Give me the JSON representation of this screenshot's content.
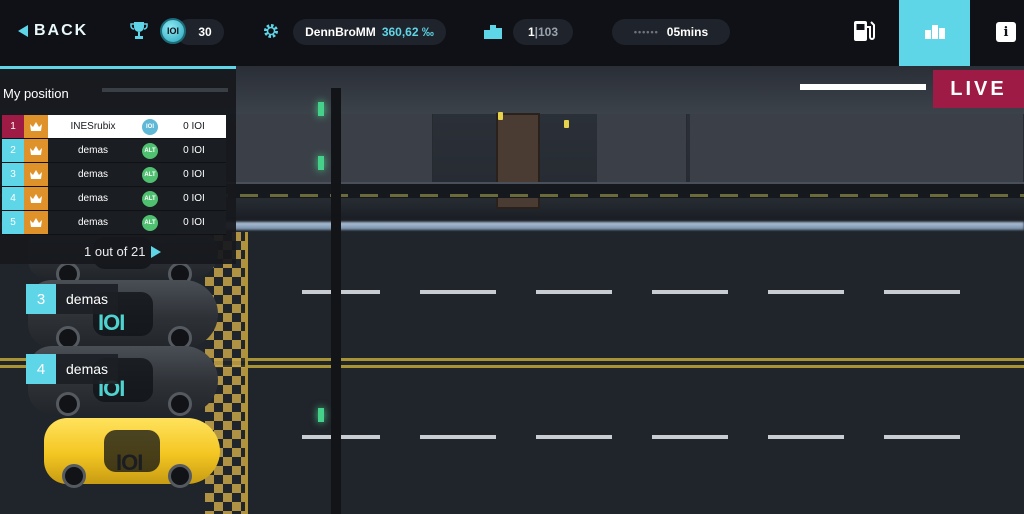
{
  "topbar": {
    "back_label": "BACK",
    "coin_symbol": "IOI",
    "coins": "30",
    "username": "DennBroMM",
    "percent": "360,62 ‰",
    "rank_current": "1",
    "rank_sep": "|",
    "rank_total": "103",
    "time_dots": "••••••",
    "time_left": "05mins",
    "info_label": "i"
  },
  "live_label": "LIVE",
  "position_panel": {
    "title": "My position",
    "rows": [
      {
        "rank": "1",
        "name": "INESrubix",
        "badge": "IOI",
        "score": "0 IOI"
      },
      {
        "rank": "2",
        "name": "demas",
        "badge": "ALT",
        "score": "0 IOI"
      },
      {
        "rank": "3",
        "name": "demas",
        "badge": "ALT",
        "score": "0 IOI"
      },
      {
        "rank": "4",
        "name": "demas",
        "badge": "ALT",
        "score": "0 IOI"
      },
      {
        "rank": "5",
        "name": "demas",
        "badge": "ALT",
        "score": "0 IOI"
      }
    ],
    "pager": "1 out of 21"
  },
  "race": {
    "rows": [
      {
        "rank": "3",
        "name": "demas"
      },
      {
        "rank": "4",
        "name": "demas"
      }
    ],
    "car_logo": "IOI"
  },
  "colors": {
    "accent": "#5fd6e8",
    "live": "#9d1b45",
    "crown": "#e0922a",
    "player_car": "#f3c622"
  }
}
